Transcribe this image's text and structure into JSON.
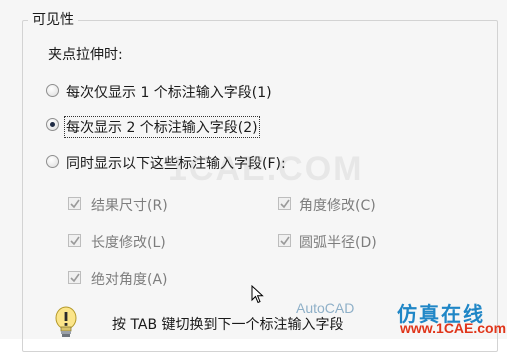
{
  "group": {
    "title": "可见性"
  },
  "grip_label": "夹点拉伸时:",
  "options": [
    {
      "label": "每次仅显示 1 个标注输入字段(1)",
      "selected": false
    },
    {
      "label": "每次显示 2 个标注输入字段(2)",
      "selected": true
    },
    {
      "label": "同时显示以下这些标注输入字段(F):",
      "selected": false
    }
  ],
  "checkboxes": [
    {
      "label": "结果尺寸(R)",
      "checked": true,
      "enabled": false
    },
    {
      "label": "角度修改(C)",
      "checked": true,
      "enabled": false
    },
    {
      "label": "长度修改(L)",
      "checked": true,
      "enabled": false
    },
    {
      "label": "圆弧半径(D)",
      "checked": true,
      "enabled": false
    },
    {
      "label": "绝对角度(A)",
      "checked": true,
      "enabled": false
    }
  ],
  "hint": "按 TAB 键切换到下一个标注输入字段",
  "watermarks": {
    "center": "1CAE.COM",
    "source": "AutoCAD",
    "site_top": "仿真在线",
    "site_bottom": "www.1CAE.com"
  },
  "colors": {
    "panel_bg": "#f6f6f6",
    "disabled_text": "#7d7d7d",
    "watermark_blue": "#1f86c6",
    "watermark_red": "#e0351a"
  },
  "icons": [
    "lightbulb-icon",
    "mouse-cursor-icon",
    "checkmark-icon"
  ]
}
